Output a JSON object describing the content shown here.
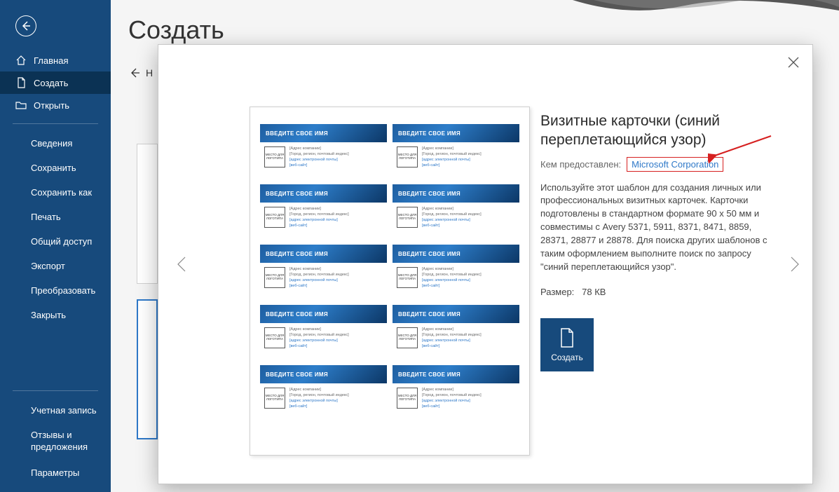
{
  "page_title": "Создать",
  "back_link_label": "Назад",
  "sidebar": {
    "main": [
      {
        "label": "Главная",
        "icon": "home"
      },
      {
        "label": "Создать",
        "icon": "doc"
      },
      {
        "label": "Открыть",
        "icon": "folder"
      }
    ],
    "sub": [
      "Сведения",
      "Сохранить",
      "Сохранить как",
      "Печать",
      "Общий доступ",
      "Экспорт",
      "Преобразовать",
      "Закрыть"
    ],
    "bottom": [
      "Учетная запись",
      "Отзывы и предложения",
      "Параметры"
    ]
  },
  "template": {
    "title": "Визитные карточки (синий переплетающийся узор)",
    "provided_label": "Кем предоставлен:",
    "provided_by": "Microsoft Corporation",
    "description": "Используйте этот шаблон для создания личных или профессиональных визитных карточек. Карточки подготовлены в стандартном формате 90 х 50 мм и совместимы с Avery 5371, 5911, 8371, 8471, 8859, 28371, 28877 и 28878. Для поиска других шаблонов с таким оформлением выполните поиск по запросу \"синий переплетающийся узор\".",
    "size_label": "Размер:",
    "size_value": "78 КВ",
    "create_label": "Создать"
  },
  "card": {
    "name": "ВВЕДИТЕ СВОЕ ИМЯ",
    "logo": "МЕСТО ДЛЯ ЛОГОТИПА",
    "line1": "[Адрес компании]",
    "line2": "[Город, регион, почтовый индекс]",
    "line3": "[адрес электронной почты]",
    "line4": "[веб-сайт]"
  }
}
